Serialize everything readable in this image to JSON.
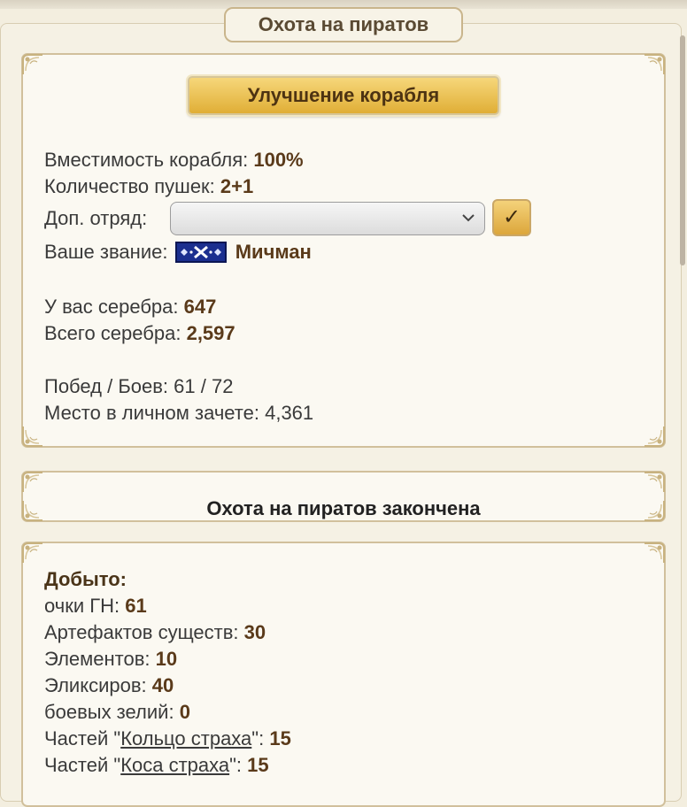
{
  "header": {
    "title": "Охота на пиратов"
  },
  "ship_panel": {
    "upgrade_button": "Улучшение корабля",
    "capacity_label": "Вместимость корабля:",
    "capacity_value": "100%",
    "cannons_label": "Количество пушек:",
    "cannons_value": "2+1",
    "squad_label": "Доп. отряд:",
    "squad_select_value": "",
    "confirm_button": "✓",
    "rank_label": "Ваше звание:",
    "rank_value": "Мичман",
    "silver_label": "У вас серебра:",
    "silver_value": "647",
    "total_silver_label": "Всего серебра:",
    "total_silver_value": "2,597",
    "wins_battles": "Побед / Боев: 61 / 72",
    "place": "Место в личном зачете: 4,361"
  },
  "status_panel": {
    "text": "Охота на пиратов закончена"
  },
  "loot_panel": {
    "heading": "Добыто:",
    "items": [
      {
        "label": "очки ГН:",
        "value": "61"
      },
      {
        "label": "Артефактов существ:",
        "value": "30"
      },
      {
        "label": "Элементов:",
        "value": "10"
      },
      {
        "label": "Эликсиров:",
        "value": "40"
      },
      {
        "label": "боевых зелий:",
        "value": "0"
      }
    ],
    "ring_prefix": "Частей \"",
    "ring_link": "Кольцо страха",
    "ring_suffix": "\":",
    "ring_value": "15",
    "scythe_prefix": "Частей \"",
    "scythe_link": "Коса страха",
    "scythe_suffix": "\":",
    "scythe_value": "15"
  },
  "colors": {
    "accent_gold": "#e0ae36",
    "frame": "#d1c09c",
    "text_brown": "#5a3a1a"
  }
}
